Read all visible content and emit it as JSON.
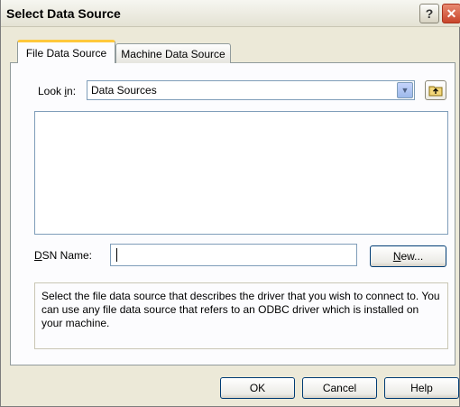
{
  "window": {
    "title": "Select Data Source",
    "help_glyph": "?",
    "close_glyph": "✕"
  },
  "tabs": [
    {
      "label": "File Data Source",
      "active": true
    },
    {
      "label": "Machine Data Source",
      "active": false
    }
  ],
  "look_in": {
    "label_prefix": "Look ",
    "label_accel": "i",
    "label_suffix": "n:",
    "value": "Data Sources",
    "dropdown_glyph": "▼",
    "up_folder_icon": "up-folder-icon"
  },
  "dsn": {
    "label_accel": "D",
    "label_rest": "SN Name:",
    "value": ""
  },
  "new_button": {
    "accel": "N",
    "rest": "ew..."
  },
  "description": "Select the file data source that describes the driver that you wish to connect to. You can use any file data source that refers to an ODBC driver which is installed on your machine.",
  "footer": {
    "ok": "OK",
    "cancel": "Cancel",
    "help": "Help"
  },
  "colors": {
    "dialog_bg": "#ece9d8",
    "active_tab_accent": "#ffc83c",
    "field_border": "#7f9db9",
    "button_border": "#003c74",
    "close_red": "#c8452b"
  }
}
